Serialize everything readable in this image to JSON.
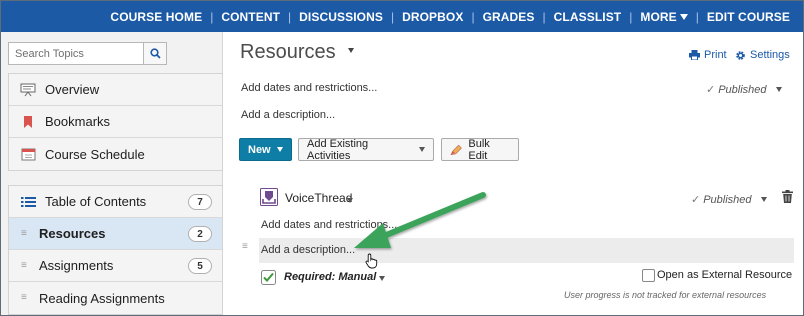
{
  "topnav": {
    "links": [
      "COURSE HOME",
      "CONTENT",
      "DISCUSSIONS",
      "DROPBOX",
      "GRADES",
      "CLASSLIST",
      "MORE",
      "EDIT COURSE"
    ]
  },
  "sidebar": {
    "search": {
      "placeholder": "Search Topics"
    },
    "group1": [
      "Overview",
      "Bookmarks",
      "Course Schedule"
    ],
    "group2": [
      {
        "label": "Table of Contents",
        "count": "7"
      },
      {
        "label": "Resources",
        "count": "2"
      },
      {
        "label": "Assignments",
        "count": "5"
      },
      {
        "label": "Reading Assignments",
        "count": ""
      }
    ]
  },
  "main": {
    "title": "Resources",
    "print": "Print",
    "settings": "Settings",
    "add_dates": "Add dates and restrictions...",
    "add_description": "Add a description...",
    "published": "Published",
    "buttons": {
      "new": "New",
      "add_existing": "Add Existing Activities",
      "bulk_edit": "Bulk Edit"
    },
    "item": {
      "title": "VoiceThread",
      "published": "Published",
      "add_dates": "Add dates and restrictions...",
      "add_description": "Add a description...",
      "required": "Required: Manual",
      "open_external": "Open as External Resource",
      "footnote": "User progress is not tracked for external resources"
    }
  },
  "colors": {
    "nav_bar": "#1c5aa6",
    "primary_button": "#0f7ea6",
    "annotation_arrow": "#3aa35a"
  }
}
